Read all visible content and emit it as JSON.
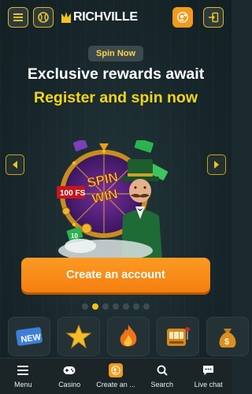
{
  "header": {
    "logo_text": "RICHVILLE"
  },
  "promo": {
    "badge": "Spin Now",
    "line1": "Exclusive rewards await",
    "line2": "Register and spin now",
    "art_labels": {
      "spin": "SPIN",
      "win": "WIN",
      "fs": "100 FS",
      "ten": "10"
    },
    "cta": "Create an account",
    "slides": 7,
    "active_slide": 2
  },
  "categories": [
    {
      "icon": "new-badge-icon",
      "label": "NEW"
    },
    {
      "icon": "star-icon"
    },
    {
      "icon": "fire-icon"
    },
    {
      "icon": "slot-machine-icon"
    },
    {
      "icon": "money-bag-icon"
    }
  ],
  "bottom_nav": [
    {
      "label": "Menu",
      "icon": "menu-icon"
    },
    {
      "label": "Casino",
      "icon": "gamepad-icon"
    },
    {
      "label": "Create an ...",
      "icon": "add-user-icon"
    },
    {
      "label": "Search",
      "icon": "search-icon"
    },
    {
      "label": "Live chat",
      "icon": "chat-icon"
    }
  ],
  "colors": {
    "accent_orange": "#f57f10",
    "accent_yellow": "#f6d616",
    "background": "#1a2a2e"
  }
}
